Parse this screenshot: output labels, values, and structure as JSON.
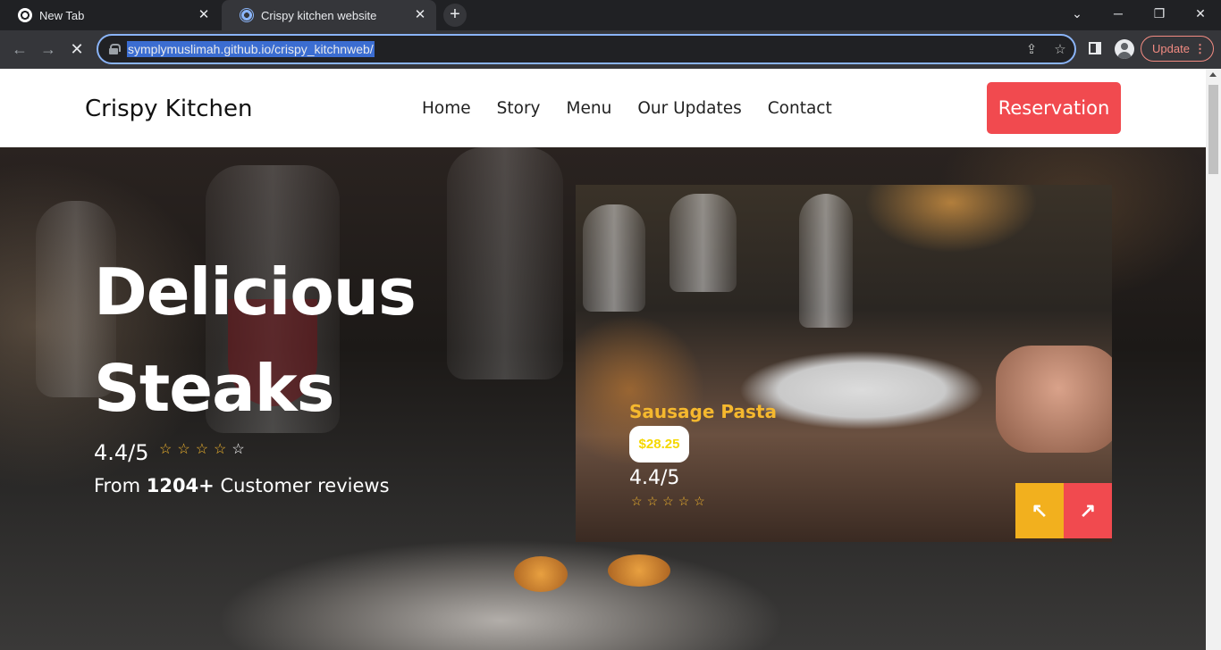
{
  "browser": {
    "tabs": [
      {
        "title": "New Tab"
      },
      {
        "title": "Crispy kitchen website"
      }
    ],
    "new_tab_symbol": "+",
    "url": "symplymuslimah.github.io/crispy_kitchnweb/",
    "update_label": "Update",
    "icons": {
      "back": "arrow-left-icon",
      "forward": "arrow-right-icon",
      "stop": "close-icon",
      "share": "share-icon",
      "bookmark": "star-icon",
      "side_panel": "side-panel-icon",
      "profile": "profile-icon",
      "menu": "kebab-menu-icon"
    }
  },
  "site": {
    "brand": "Crispy Kitchen",
    "nav": [
      "Home",
      "Story",
      "Menu",
      "Our Updates",
      "Contact"
    ],
    "reservation_label": "Reservation",
    "accent_color": "#f14a4f",
    "star_color": "#f5b82e"
  },
  "hero": {
    "title_line1": "Delicious",
    "title_line2": "Steaks",
    "rating": "4.4/5",
    "stars_filled": 4,
    "stars_total": 5,
    "reviews_prefix": "From",
    "reviews_count": "1204+",
    "reviews_suffix": "Customer reviews"
  },
  "card": {
    "title": "Sausage Pasta",
    "price": "$28.25",
    "rating": "4.4/5",
    "stars_total": 5,
    "prev_arrow": "↖",
    "next_arrow": "↗",
    "prev_color": "#f2b01e",
    "next_color": "#f14a4f"
  }
}
